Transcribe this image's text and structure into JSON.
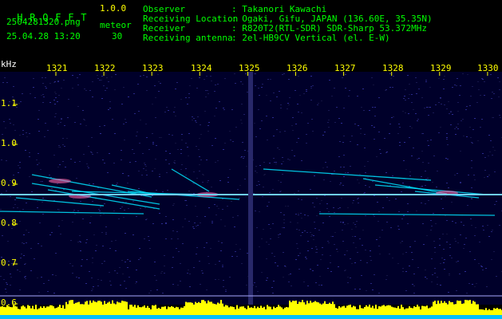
{
  "header": {
    "app_title_chars": [
      "H",
      "R",
      "O",
      "F",
      "F",
      "T"
    ],
    "version": "1.0.0",
    "filename": "2504281320.png",
    "datetime": "25.04.28 13:20",
    "meteor_label": "meteor",
    "meteor_count": "30",
    "info": [
      {
        "label": "Observer",
        "value": ": Takanori Kawachi"
      },
      {
        "label": "Receiving Location",
        "value": ": Ogaki, Gifu, JAPAN (136.60E, 35.35N)"
      },
      {
        "label": "Receiver",
        "value": ": R820T2(RTL-SDR) SDR-Sharp 53.372MHz"
      },
      {
        "label": "Receiving antenna",
        "value": ": 2el-HB9CV Vertical (el. E-W)"
      }
    ]
  },
  "axes": {
    "y_unit": "kHz",
    "minute_labels": [
      "1321",
      "1322",
      "1323",
      "1324",
      "1325",
      "1326",
      "1327",
      "1328",
      "1329",
      "1330"
    ],
    "freq_labels": [
      "1.1",
      "1.0",
      "0.9",
      "0.8",
      "0.7",
      "0.6"
    ]
  },
  "colors": {
    "header_text": "#00ff00",
    "version": "#ffff00",
    "spectrum_bg": "#000044",
    "meteor": "#00e5ff",
    "axis_text": "#ffff00",
    "level_bar": "#ffff00",
    "level_base": "#00bfff"
  }
}
